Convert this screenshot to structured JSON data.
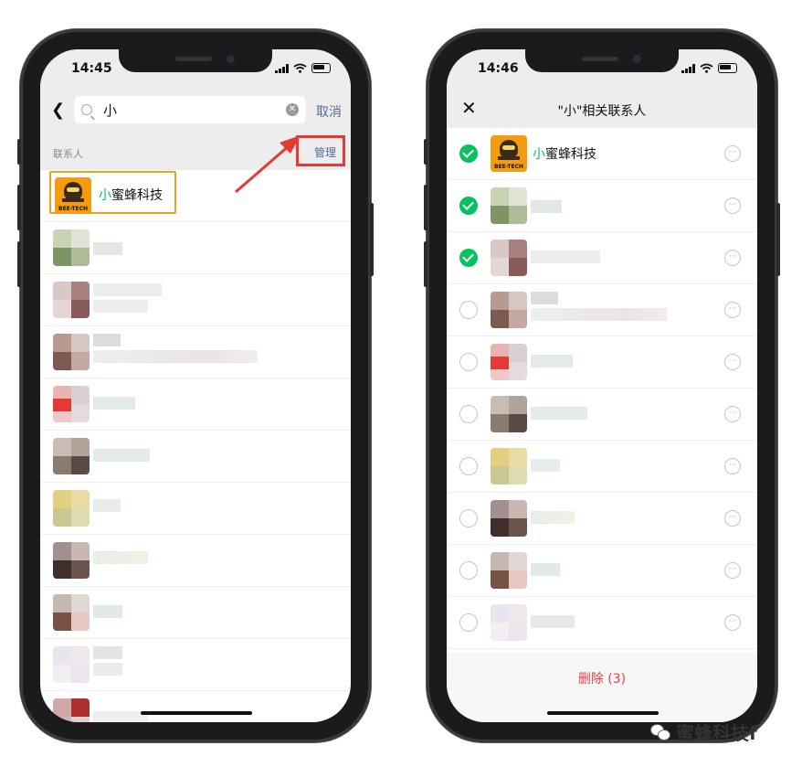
{
  "left": {
    "time": "14:45",
    "search": {
      "value": "小",
      "cancel": "取消"
    },
    "section": {
      "label": "联系人",
      "manage": "管理"
    },
    "first_contact": {
      "highlight": "小",
      "rest": "蜜蜂科技",
      "avatar_label": "BEE-TECH"
    }
  },
  "right": {
    "time": "14:46",
    "title": "\"小\"相关联系人",
    "first_contact": {
      "highlight": "小",
      "rest": "蜜蜂科技",
      "avatar_label": "BEE-TECH"
    },
    "checked_rows": [
      true,
      true,
      true,
      false,
      false,
      false,
      false,
      false,
      false,
      false
    ],
    "more_glyph": "···",
    "delete_label": "删除 (3)"
  },
  "watermark": {
    "text": "蜜蜂科技f"
  },
  "colors": {
    "accent_green": "#07c160",
    "link_blue": "#576b95",
    "danger_red": "#e64340",
    "annotation_red": "#e53935",
    "highlight_orange": "#f0a020"
  }
}
